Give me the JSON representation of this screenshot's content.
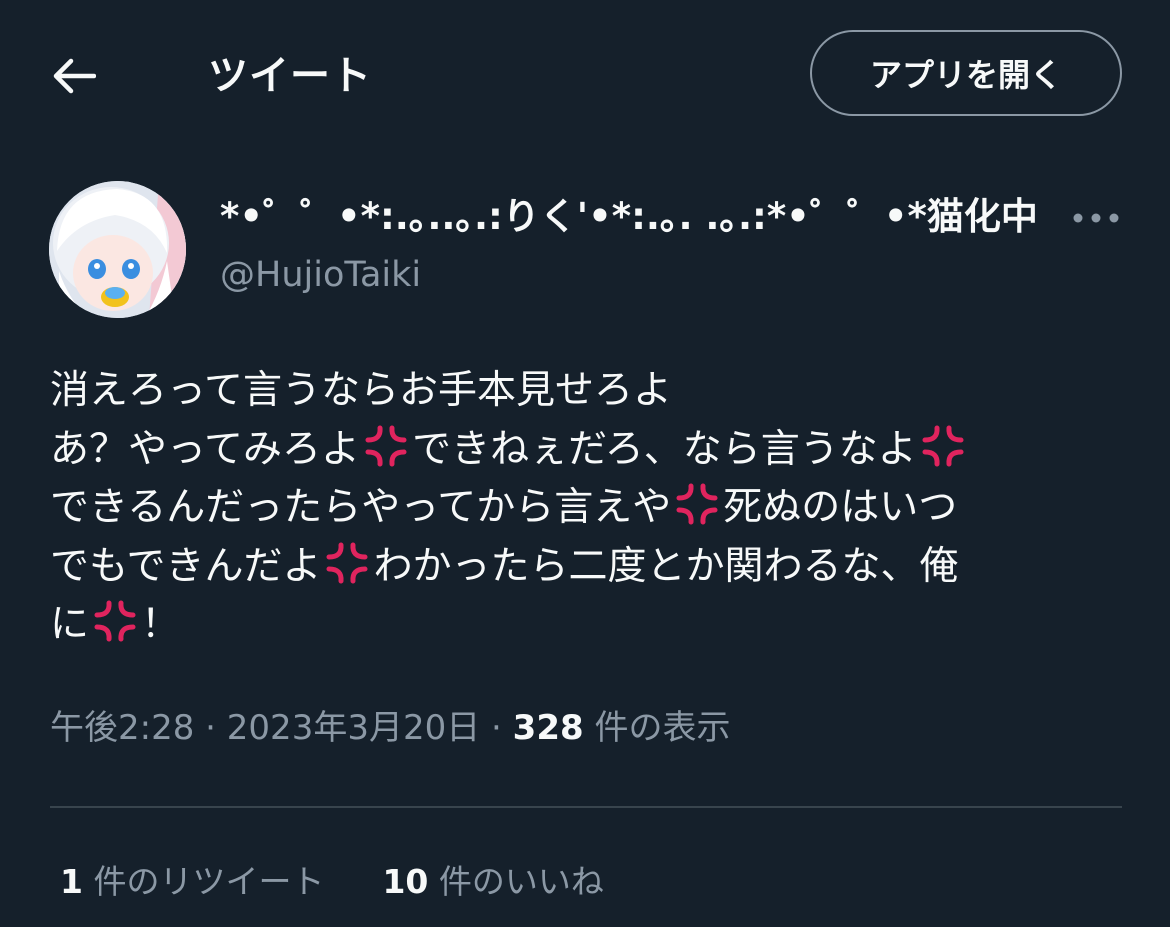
{
  "header": {
    "back_icon": "arrow-left-icon",
    "title": "ツイート",
    "open_app_label": "アプリを開く"
  },
  "tweet": {
    "display_name": "*•゜゜•*:.｡..｡.:りく'•*:.｡. .｡.:*•゜゜•*猫化中",
    "handle": "@HujioTaiki",
    "more_icon": "more-horizontal-icon",
    "emoji_icon": "anger-symbol-icon",
    "emoji_color": "#e0245e",
    "body_segments": [
      "消えろって言うならお手本見せろよ",
      "あ？やってみろよ",
      "できねぇだろ、なら言うなよ",
      "できるんだったらやってから言えや",
      "死ぬのはいつ",
      "でもできんだよ",
      "わかったら二度とか関わるな、俺",
      "に",
      "！"
    ],
    "time": "午後2:28",
    "date": "2023年3月20日",
    "separator": "·",
    "views_count": "328",
    "views_label": "件の表示"
  },
  "stats": {
    "retweets_count": "1",
    "retweets_label": "件のリツイート",
    "likes_count": "10",
    "likes_label": "件のいいね"
  },
  "colors": {
    "background": "#15202b",
    "text_primary": "#f7f9f9",
    "text_secondary": "#8b98a5",
    "divider": "#38444d"
  }
}
